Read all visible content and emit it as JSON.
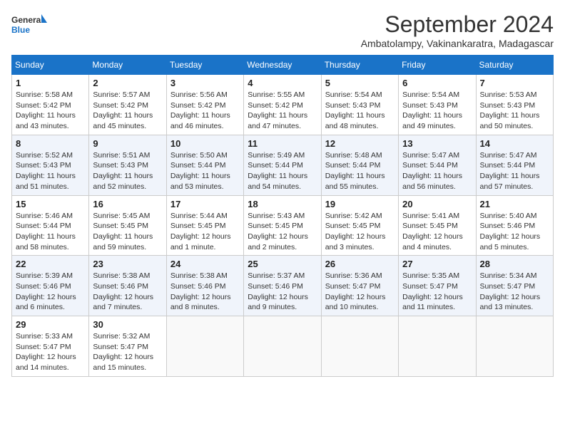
{
  "header": {
    "logo_line1": "General",
    "logo_line2": "Blue",
    "month": "September 2024",
    "location": "Ambatolampy, Vakinankaratra, Madagascar"
  },
  "days_of_week": [
    "Sunday",
    "Monday",
    "Tuesday",
    "Wednesday",
    "Thursday",
    "Friday",
    "Saturday"
  ],
  "weeks": [
    [
      {
        "day": "1",
        "sunrise": "5:58 AM",
        "sunset": "5:42 PM",
        "daylight": "11 hours and 43 minutes."
      },
      {
        "day": "2",
        "sunrise": "5:57 AM",
        "sunset": "5:42 PM",
        "daylight": "11 hours and 45 minutes."
      },
      {
        "day": "3",
        "sunrise": "5:56 AM",
        "sunset": "5:42 PM",
        "daylight": "11 hours and 46 minutes."
      },
      {
        "day": "4",
        "sunrise": "5:55 AM",
        "sunset": "5:42 PM",
        "daylight": "11 hours and 47 minutes."
      },
      {
        "day": "5",
        "sunrise": "5:54 AM",
        "sunset": "5:43 PM",
        "daylight": "11 hours and 48 minutes."
      },
      {
        "day": "6",
        "sunrise": "5:54 AM",
        "sunset": "5:43 PM",
        "daylight": "11 hours and 49 minutes."
      },
      {
        "day": "7",
        "sunrise": "5:53 AM",
        "sunset": "5:43 PM",
        "daylight": "11 hours and 50 minutes."
      }
    ],
    [
      {
        "day": "8",
        "sunrise": "5:52 AM",
        "sunset": "5:43 PM",
        "daylight": "11 hours and 51 minutes."
      },
      {
        "day": "9",
        "sunrise": "5:51 AM",
        "sunset": "5:43 PM",
        "daylight": "11 hours and 52 minutes."
      },
      {
        "day": "10",
        "sunrise": "5:50 AM",
        "sunset": "5:44 PM",
        "daylight": "11 hours and 53 minutes."
      },
      {
        "day": "11",
        "sunrise": "5:49 AM",
        "sunset": "5:44 PM",
        "daylight": "11 hours and 54 minutes."
      },
      {
        "day": "12",
        "sunrise": "5:48 AM",
        "sunset": "5:44 PM",
        "daylight": "11 hours and 55 minutes."
      },
      {
        "day": "13",
        "sunrise": "5:47 AM",
        "sunset": "5:44 PM",
        "daylight": "11 hours and 56 minutes."
      },
      {
        "day": "14",
        "sunrise": "5:47 AM",
        "sunset": "5:44 PM",
        "daylight": "11 hours and 57 minutes."
      }
    ],
    [
      {
        "day": "15",
        "sunrise": "5:46 AM",
        "sunset": "5:44 PM",
        "daylight": "11 hours and 58 minutes."
      },
      {
        "day": "16",
        "sunrise": "5:45 AM",
        "sunset": "5:45 PM",
        "daylight": "11 hours and 59 minutes."
      },
      {
        "day": "17",
        "sunrise": "5:44 AM",
        "sunset": "5:45 PM",
        "daylight": "12 hours and 1 minute."
      },
      {
        "day": "18",
        "sunrise": "5:43 AM",
        "sunset": "5:45 PM",
        "daylight": "12 hours and 2 minutes."
      },
      {
        "day": "19",
        "sunrise": "5:42 AM",
        "sunset": "5:45 PM",
        "daylight": "12 hours and 3 minutes."
      },
      {
        "day": "20",
        "sunrise": "5:41 AM",
        "sunset": "5:45 PM",
        "daylight": "12 hours and 4 minutes."
      },
      {
        "day": "21",
        "sunrise": "5:40 AM",
        "sunset": "5:46 PM",
        "daylight": "12 hours and 5 minutes."
      }
    ],
    [
      {
        "day": "22",
        "sunrise": "5:39 AM",
        "sunset": "5:46 PM",
        "daylight": "12 hours and 6 minutes."
      },
      {
        "day": "23",
        "sunrise": "5:38 AM",
        "sunset": "5:46 PM",
        "daylight": "12 hours and 7 minutes."
      },
      {
        "day": "24",
        "sunrise": "5:38 AM",
        "sunset": "5:46 PM",
        "daylight": "12 hours and 8 minutes."
      },
      {
        "day": "25",
        "sunrise": "5:37 AM",
        "sunset": "5:46 PM",
        "daylight": "12 hours and 9 minutes."
      },
      {
        "day": "26",
        "sunrise": "5:36 AM",
        "sunset": "5:47 PM",
        "daylight": "12 hours and 10 minutes."
      },
      {
        "day": "27",
        "sunrise": "5:35 AM",
        "sunset": "5:47 PM",
        "daylight": "12 hours and 11 minutes."
      },
      {
        "day": "28",
        "sunrise": "5:34 AM",
        "sunset": "5:47 PM",
        "daylight": "12 hours and 13 minutes."
      }
    ],
    [
      {
        "day": "29",
        "sunrise": "5:33 AM",
        "sunset": "5:47 PM",
        "daylight": "12 hours and 14 minutes."
      },
      {
        "day": "30",
        "sunrise": "5:32 AM",
        "sunset": "5:47 PM",
        "daylight": "12 hours and 15 minutes."
      },
      null,
      null,
      null,
      null,
      null
    ]
  ],
  "labels": {
    "sunrise": "Sunrise: ",
    "sunset": "Sunset: ",
    "daylight": "Daylight: "
  }
}
